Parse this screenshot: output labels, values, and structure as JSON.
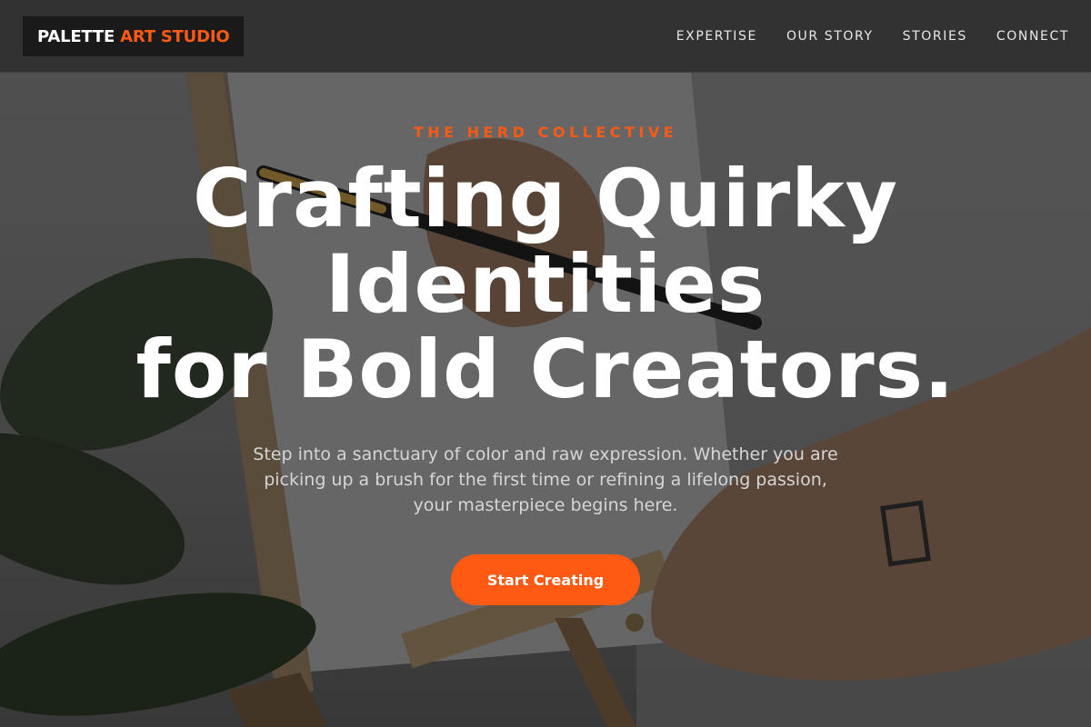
{
  "theme": {
    "accent": "#ff5a14",
    "nav_bg": "#303030",
    "logo_bg": "#1a1a1a",
    "text": "#ffffff"
  },
  "navbar": {
    "logo": {
      "primary": "PALETTE",
      "accent": "ART STUDIO"
    },
    "links": [
      {
        "label": "EXPERTISE"
      },
      {
        "label": "OUR STORY"
      },
      {
        "label": "STORIES"
      },
      {
        "label": "CONNECT"
      }
    ]
  },
  "hero": {
    "background_image": "hand painting on canvas easel",
    "eyebrow": "THE HERD COLLECTIVE",
    "headline_lines": [
      "Crafting Quirky",
      "Identities",
      "for Bold Creators."
    ],
    "subtext": "Step into a sanctuary of color and raw expression. Whether you are picking up a brush for the first time or refining a lifelong passion, your masterpiece begins here.",
    "cta_label": "Start Creating"
  }
}
